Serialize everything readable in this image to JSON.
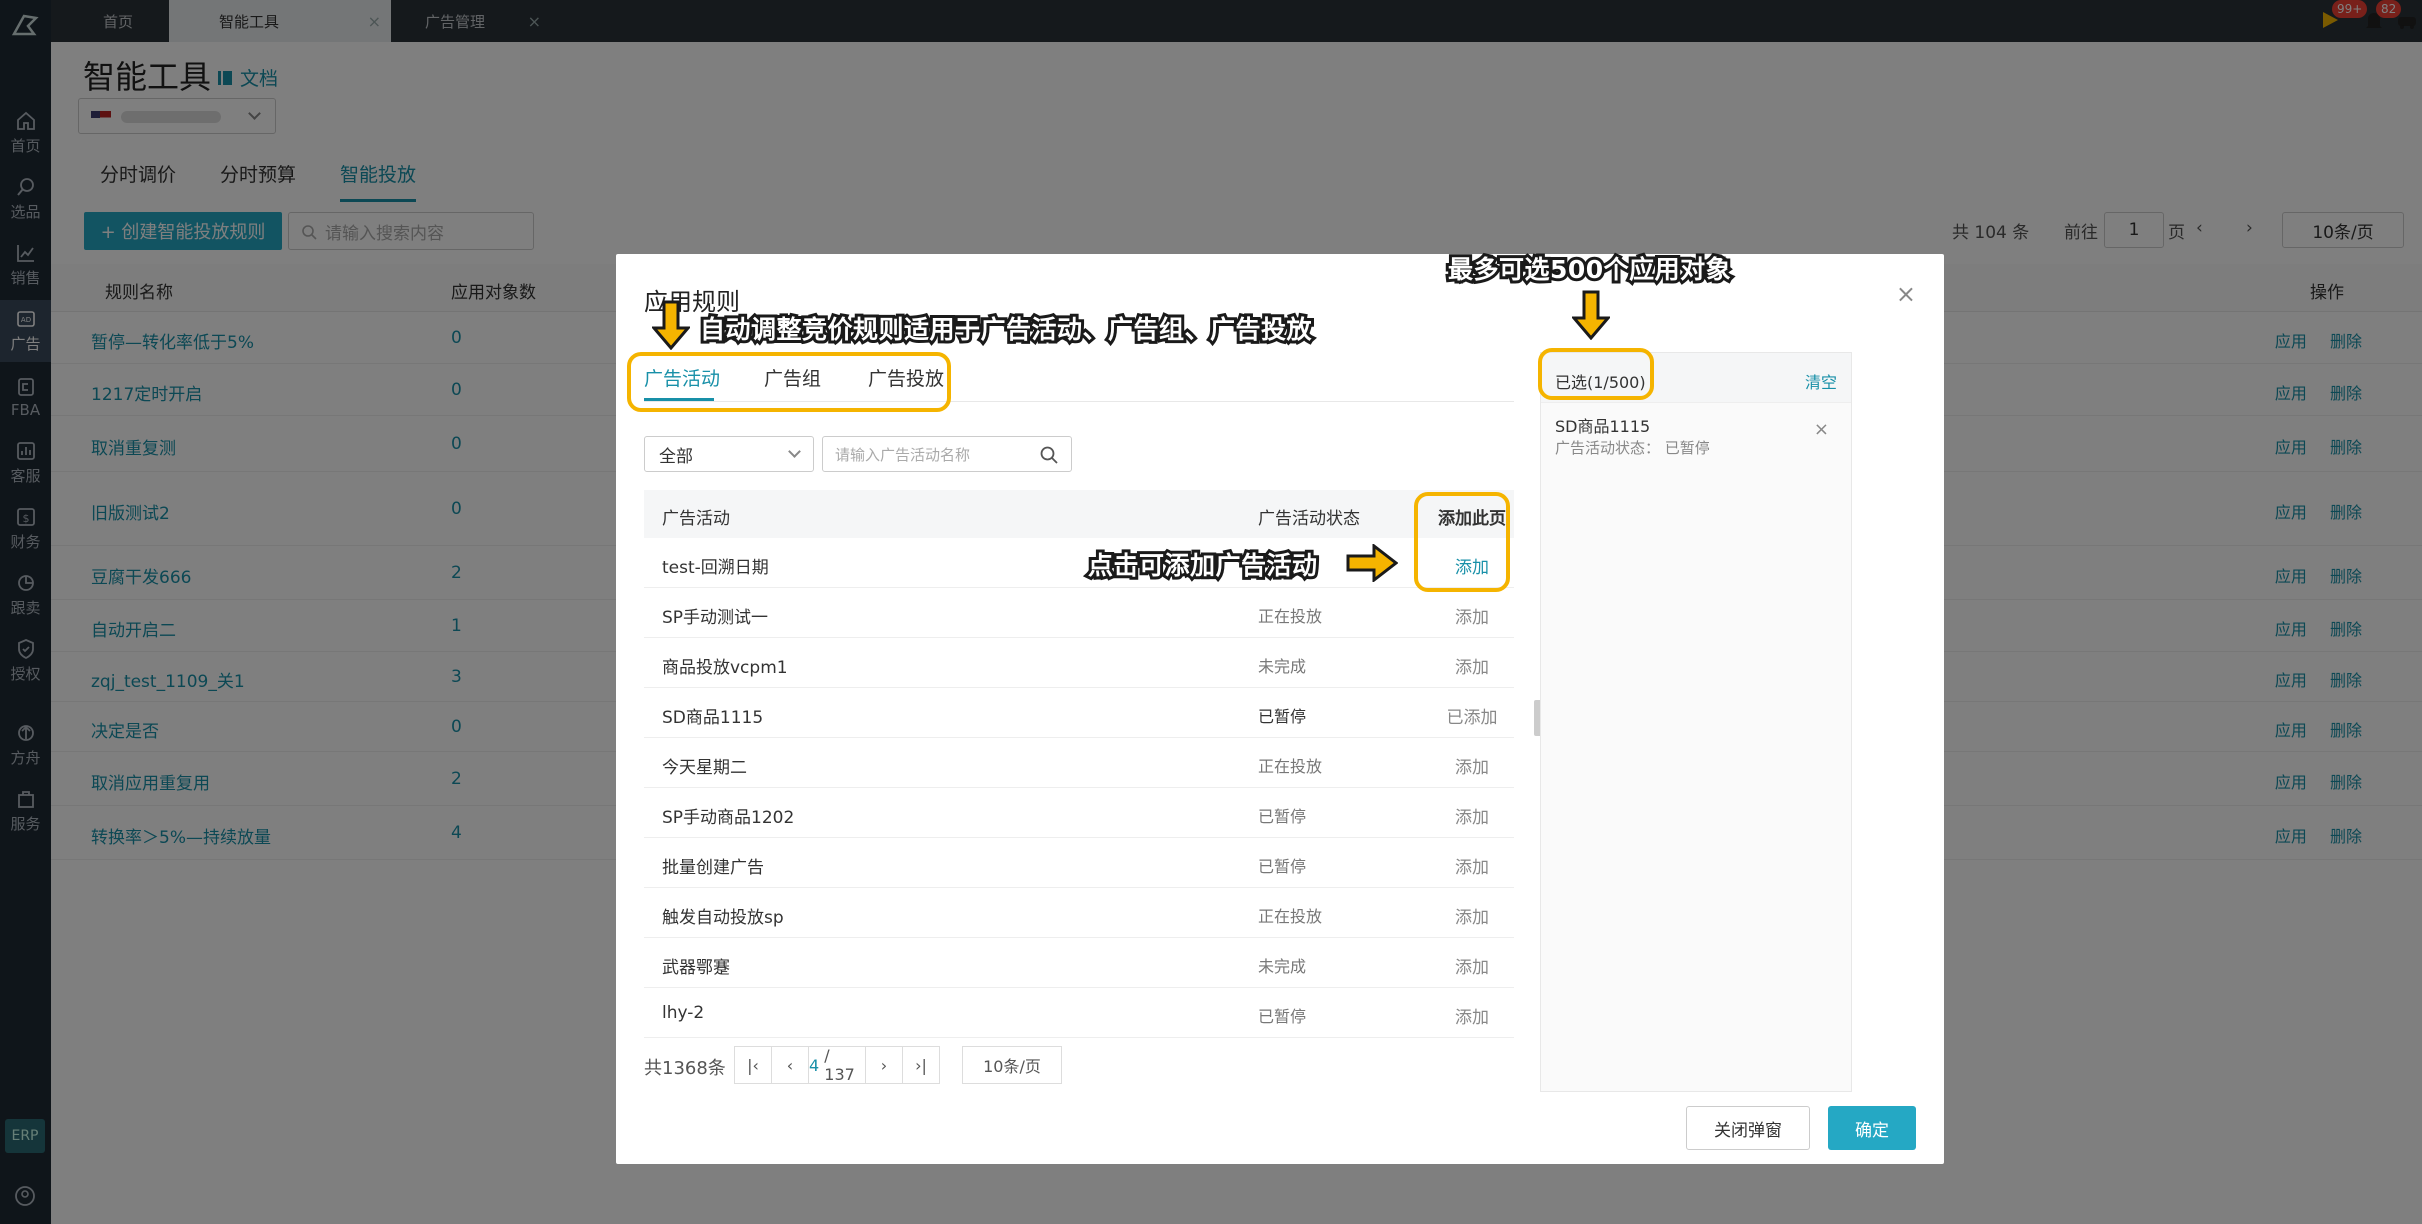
{
  "sidebar": {
    "items": [
      {
        "label": "首页",
        "icon": "home-icon"
      },
      {
        "label": "选品",
        "icon": "search-icon"
      },
      {
        "label": "销售",
        "icon": "chart-icon"
      },
      {
        "label": "广告",
        "icon": "ad-icon"
      },
      {
        "label": "FBA",
        "icon": "fba-icon"
      },
      {
        "label": "客服",
        "icon": "customer-service-icon"
      },
      {
        "label": "财务",
        "icon": "finance-icon"
      },
      {
        "label": "跟卖",
        "icon": "pie-icon"
      },
      {
        "label": "授权",
        "icon": "shield-icon"
      },
      {
        "label": "方舟",
        "icon": "ark-icon"
      },
      {
        "label": "服务",
        "icon": "service-icon"
      }
    ],
    "erp_label": "ERP"
  },
  "topbar": {
    "tabs": [
      {
        "label": "首页"
      },
      {
        "label": "智能工具"
      },
      {
        "label": "广告管理"
      }
    ],
    "badge_flag": "99+",
    "badge_bell": "82"
  },
  "page": {
    "title": "智能工具",
    "doc_link": "文档",
    "subtabs": [
      "分时调价",
      "分时预算",
      "智能投放"
    ],
    "create_button": "+ 创建智能投放规则",
    "search_placeholder": "请输入搜索内容",
    "total": "共 104 条",
    "goto_label": "前往",
    "goto_value": "1",
    "page_suffix": "页",
    "page_size": "10条/页",
    "columns": {
      "name": "规则名称",
      "count": "应用对象数",
      "ops": "操作"
    },
    "rows": [
      {
        "name": "暂停—转化率低于5%",
        "count": "0"
      },
      {
        "name": "1217定时开启",
        "count": "0"
      },
      {
        "name": "取消重复测",
        "count": "0"
      },
      {
        "name": "旧版测试2",
        "count": "0"
      },
      {
        "name": "豆腐干发666",
        "count": "2"
      },
      {
        "name": "自动开启二",
        "count": "1"
      },
      {
        "name": "zqj_test_1109_关1",
        "count": "3"
      },
      {
        "name": "决定是否",
        "count": "0"
      },
      {
        "name": "取消应用重复用",
        "count": "2"
      },
      {
        "name": "转换率＞5%—持续放量",
        "count": "4"
      }
    ],
    "row_actions": "应用 删除"
  },
  "modal": {
    "title": "应用规则",
    "tabs": [
      "广告活动",
      "广告组",
      "广告投放"
    ],
    "filter_value": "全部",
    "search_placeholder": "请输入广告活动名称",
    "columns": {
      "name": "广告活动",
      "status": "广告活动状态",
      "action": "添加此页"
    },
    "rows": [
      {
        "name": "test-回溯日期",
        "status": "",
        "action": "添加",
        "link": true
      },
      {
        "name": "SP手动测试一",
        "status": "正在投放",
        "action": "添加"
      },
      {
        "name": "商品投放vcpm1",
        "status": "未完成",
        "action": "添加"
      },
      {
        "name": "SD商品1115",
        "status": "已暂停",
        "action": "已添加",
        "bold": true
      },
      {
        "name": "今天星期二",
        "status": "正在投放",
        "action": "添加"
      },
      {
        "name": "SP手动商品1202",
        "status": "已暂停",
        "action": "添加"
      },
      {
        "name": "批量创建广告",
        "status": "已暂停",
        "action": "添加"
      },
      {
        "name": "触发自动投放sp",
        "status": "正在投放",
        "action": "添加"
      },
      {
        "name": "武器鄂蹇",
        "status": "未完成",
        "action": "添加"
      },
      {
        "name": "lhy-2",
        "status": "已暂停",
        "action": "添加"
      }
    ],
    "pager": {
      "total": "共1368条",
      "current": "4",
      "total_pages": "/ 137",
      "page_size": "10条/页"
    },
    "selected": {
      "count": "已选(1/500)",
      "clear": "清空",
      "items": [
        {
          "name": "SD商品1115",
          "status": "广告活动状态：  已暂停"
        }
      ]
    },
    "close_button": "关闭弹窗",
    "ok_button": "确定"
  },
  "annotations": {
    "tabs_note": "自动调整竞价规则适用于广告活动、广告组、广告投放",
    "limit_note": "最多可选500个应用对象",
    "add_note": "点击可添加广告活动"
  },
  "colors": {
    "accent": "#25a8c4",
    "link": "#1890a8",
    "annotation": "#f5b400",
    "sidebar": "#1f2a34"
  }
}
